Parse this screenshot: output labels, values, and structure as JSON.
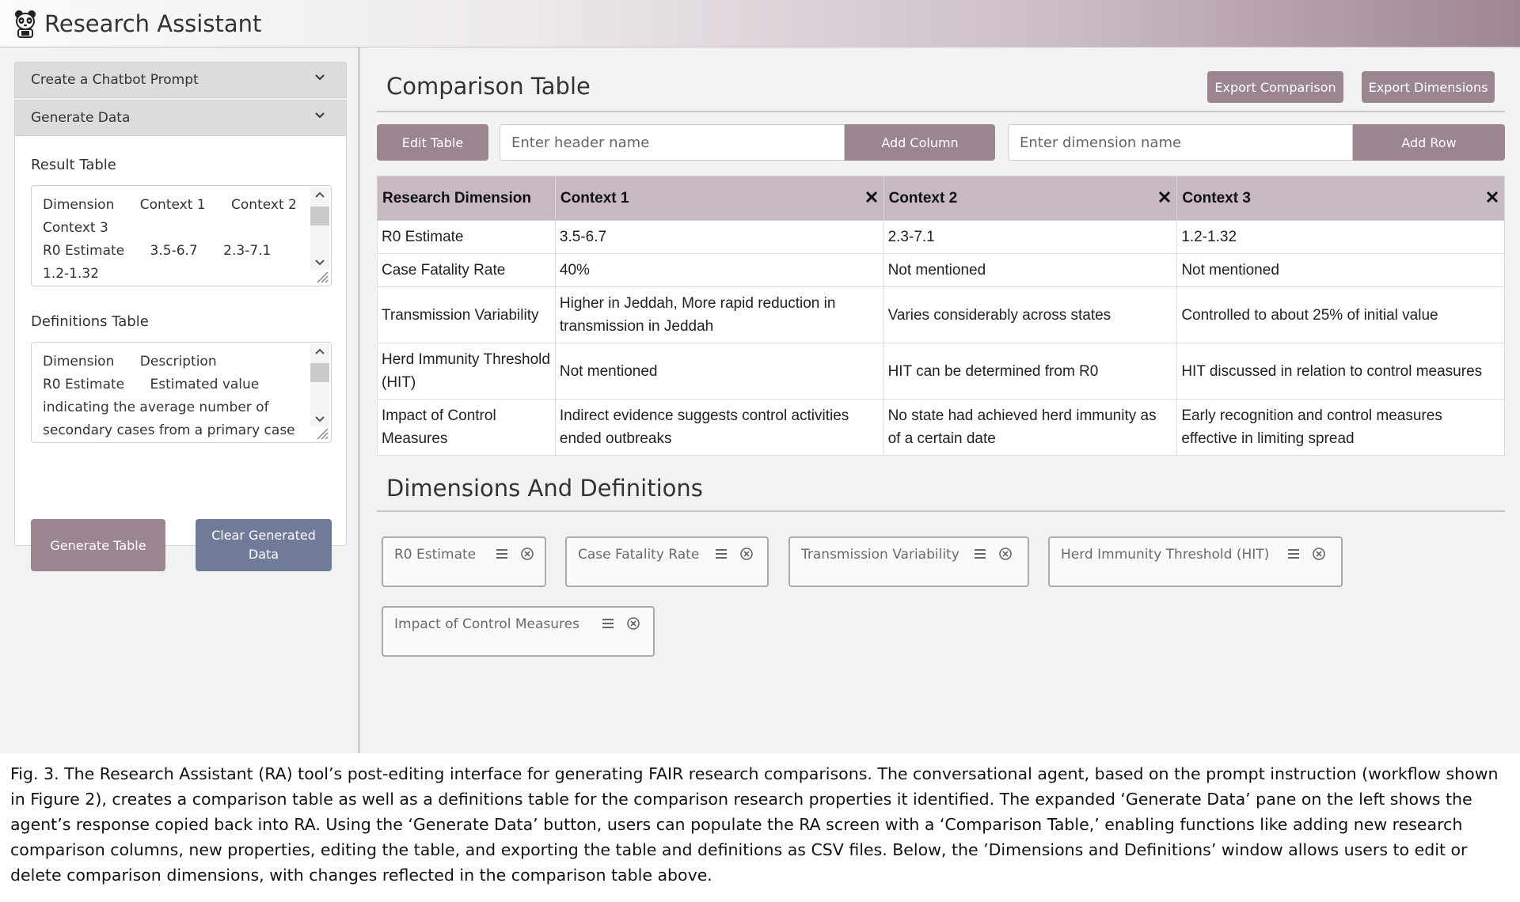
{
  "app": {
    "title": "Research Assistant",
    "logo_icon": "panda-icon"
  },
  "sidebar": {
    "accordion": [
      {
        "label": "Create a Chatbot Prompt",
        "icon": "chevron-down-icon"
      },
      {
        "label": "Generate Data",
        "icon": "chevron-down-icon"
      }
    ],
    "result_table": {
      "label": "Result Table",
      "value": "Dimension      Context 1      Context 2      Context 3\nR0 Estimate      3.5-6.7      2.3-7.1      1.2-1.32"
    },
    "definitions_table": {
      "label": "Definitions Table",
      "value": "Dimension      Description\nR0 Estimate      Estimated value indicating the average number of secondary cases from a primary case"
    },
    "generate_button": "Generate Table",
    "clear_button": "Clear Generated Data"
  },
  "main": {
    "comparison_title": "Comparison Table",
    "export_comparison": "Export Comparison",
    "export_dimensions": "Export Dimensions",
    "edit_table": "Edit Table",
    "header_placeholder": "Enter header name",
    "add_column": "Add Column",
    "dimension_placeholder": "Enter dimension name",
    "add_row": "Add Row",
    "table": {
      "headers": [
        "Research Dimension",
        "Context 1",
        "Context 2",
        "Context 3"
      ],
      "rows": [
        [
          "R0 Estimate",
          "3.5-6.7",
          "2.3-7.1",
          "1.2-1.32"
        ],
        [
          "Case Fatality Rate",
          "40%",
          "Not mentioned",
          "Not mentioned"
        ],
        [
          "Transmission Variability",
          "Higher in Jeddah, More rapid reduction in transmission in Jeddah",
          "Varies considerably across states",
          "Controlled to about 25% of initial value"
        ],
        [
          "Herd Immunity Threshold (HIT)",
          "Not mentioned",
          "HIT can be determined from R0",
          "HIT discussed in relation to control measures"
        ],
        [
          "Impact of Control Measures",
          "Indirect evidence suggests control activities ended outbreaks",
          "No state had achieved herd immunity as of a certain date",
          "Early recognition and control measures effective in limiting spread"
        ]
      ]
    },
    "dimensions_title": "Dimensions And Definitions",
    "dimensions": [
      "R0 Estimate",
      "Case Fatality Rate",
      "Transmission Variability",
      "Herd Immunity Threshold (HIT)",
      "Impact of Control Measures"
    ]
  },
  "caption": "Fig. 3. The Research Assistant (RA) tool’s post-editing interface for generating FAIR research comparisons. The conversational agent, based on the prompt instruction (workflow shown in Figure 2), creates a comparison table as well as a definitions table for the comparison research properties it identified. The expanded ‘Generate Data’ pane on the left shows the agent’s response copied back into RA. Using the ‘Generate Data’ button, users can populate the RA screen with a ‘Comparison Table,’ enabling functions like adding new research comparison columns, new properties, editing the table, and exporting the table and definitions as CSV files. Below, the ’Dimensions and Definitions’ window allows users to edit or delete comparison dimensions, with changes reflected in the comparison table above."
}
